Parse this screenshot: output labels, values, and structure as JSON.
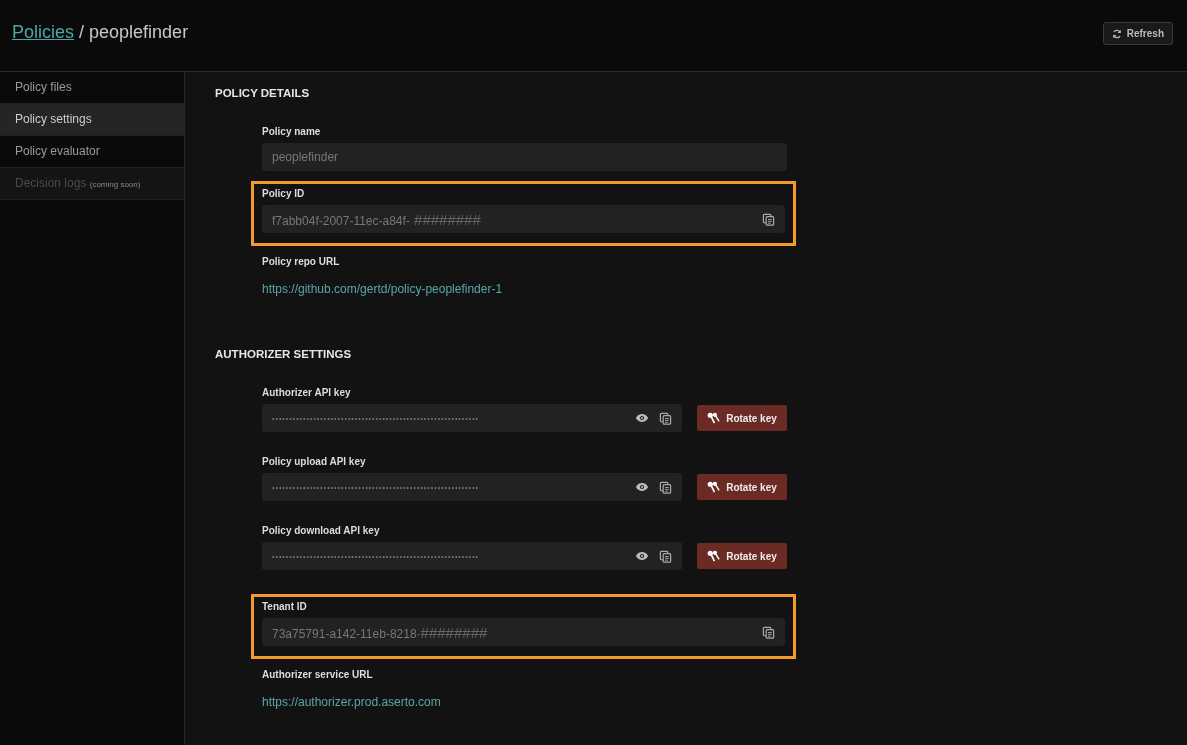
{
  "header": {
    "breadcrumb_link": "Policies",
    "separator": "/",
    "title": "peoplefinder",
    "refresh_button": "Refresh"
  },
  "sidebar": {
    "items": [
      {
        "label": "Policy files",
        "selected": false,
        "disabled": false
      },
      {
        "label": "Policy settings",
        "selected": true,
        "disabled": false
      },
      {
        "label": "Policy evaluator",
        "selected": false,
        "disabled": false
      },
      {
        "label": "Decision logs",
        "note": "(coming soon)",
        "selected": false,
        "disabled": true
      }
    ]
  },
  "sections": [
    {
      "title": "POLICY DETAILS",
      "fields": [
        {
          "kind": "text",
          "label": "Policy name",
          "value": "peoplefinder",
          "highlighted": false,
          "copy": false
        },
        {
          "kind": "text",
          "label": "Policy ID",
          "value": "f7abb04f-2007-11ec-a84f-",
          "redacted": " ########",
          "highlighted": true,
          "copy": true
        },
        {
          "kind": "link",
          "label": "Policy repo URL",
          "value": "https://github.com/gertd/policy-peoplefinder-1",
          "highlighted": false
        }
      ]
    },
    {
      "title": "AUTHORIZER SETTINGS",
      "fields": [
        {
          "kind": "secret",
          "label": "Authorizer API key",
          "value": "••••••••••••••••••••••••••••••••••••••••••••••••••••••••••••",
          "button": "Rotate key",
          "highlighted": false
        },
        {
          "kind": "secret",
          "label": "Policy upload API key",
          "value": "••••••••••••••••••••••••••••••••••••••••••••••••••••••••••••",
          "button": "Rotate key",
          "highlighted": false
        },
        {
          "kind": "secret",
          "label": "Policy download API key",
          "value": "••••••••••••••••••••••••••••••••••••••••••••••••••••••••••••",
          "button": "Rotate key",
          "highlighted": false
        },
        {
          "kind": "text",
          "label": "Tenant ID",
          "value": "73a75791-a142-11eb-8218·",
          "redacted": "########",
          "highlighted": true,
          "copy": true
        },
        {
          "kind": "link",
          "label": "Authorizer service URL",
          "value": "https://authorizer.prod.aserto.com",
          "highlighted": false
        }
      ]
    }
  ]
}
